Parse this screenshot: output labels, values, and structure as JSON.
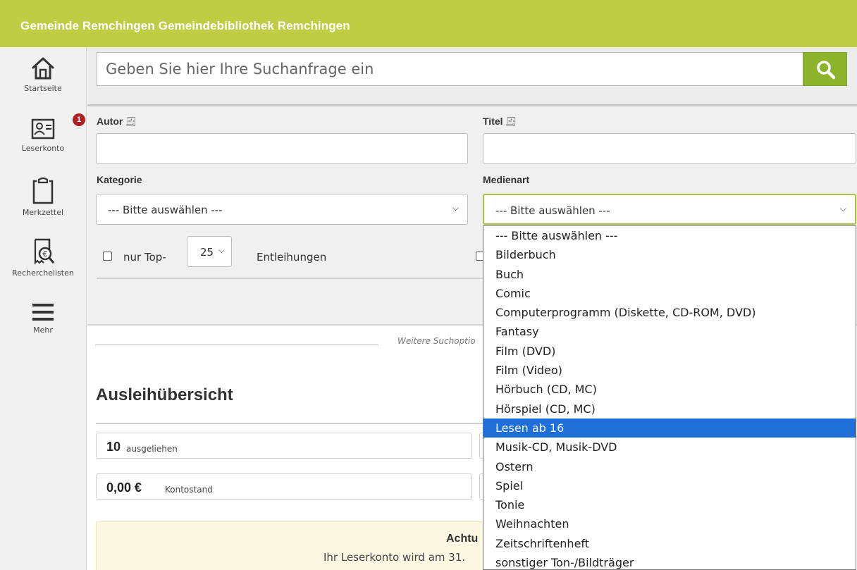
{
  "header": {
    "title": "Gemeinde Remchingen Gemeindebibliothek Remchingen"
  },
  "colors": {
    "header_bg": "#bfcd44",
    "search_button": "#8cb52c",
    "badge": "#b21f24",
    "selected_option": "#1e6fd8"
  },
  "sidebar": {
    "items": [
      {
        "label": "Startseite",
        "icon": "home-icon"
      },
      {
        "label": "Leserkonto",
        "icon": "id-card-icon",
        "badge": "1"
      },
      {
        "label": "Merkzettel",
        "icon": "clipboard-icon"
      },
      {
        "label": "Recherchelisten",
        "icon": "receipt-search-icon"
      },
      {
        "label": "Mehr",
        "icon": "hamburger-menu-icon"
      }
    ]
  },
  "search": {
    "placeholder": "Geben Sie hier Ihre Suchanfrage ein",
    "button_icon": "search-icon"
  },
  "form": {
    "author_label": "Autor",
    "title_label": "Titel",
    "label_icon": "lookup-icon",
    "category_label": "Kategorie",
    "category_value": "--- Bitte auswählen ---",
    "media_label": "Medienart",
    "media_value": "--- Bitte auswählen ---",
    "top_label": "nur Top-",
    "top_value": "25",
    "loans_label": "Entleihungen",
    "more_options": "Weitere Suchoptio"
  },
  "media_dropdown": {
    "options": [
      "--- Bitte auswählen ---",
      "Bilderbuch",
      "Buch",
      "Comic",
      "Computerprogramm (Diskette, CD-ROM, DVD)",
      "Fantasy",
      "Film (DVD)",
      "Film (Video)",
      "Hörbuch (CD, MC)",
      "Hörspiel (CD, MC)",
      "Lesen ab 16",
      "Musik-CD, Musik-DVD",
      "Ostern",
      "Spiel",
      "Tonie",
      "Weihnachten",
      "Zeitschriftenheft",
      "sonstiger Ton-/Bildträger"
    ],
    "selected": "Lesen ab 16"
  },
  "overview": {
    "title": "Ausleihübersicht",
    "loans_count": "10",
    "loans_label": "ausgeliehen",
    "balance": "0,00 €",
    "balance_label": "Kontostand",
    "warning_title": "Achtu",
    "warning_text": "Ihr Leserkonto wird am 31."
  }
}
